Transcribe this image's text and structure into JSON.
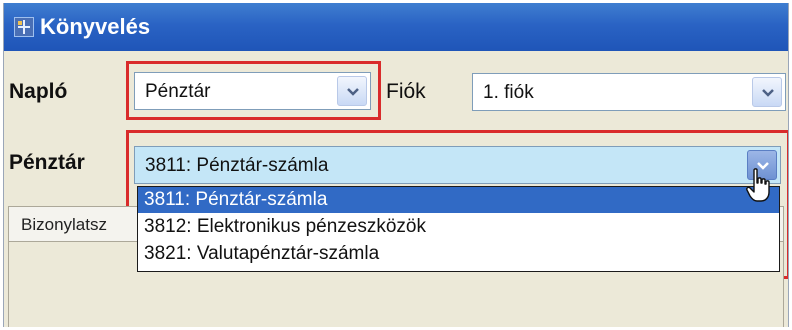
{
  "window": {
    "title": "Könyvelés",
    "icon": "app-icon"
  },
  "form": {
    "naplo": {
      "label": "Napló",
      "value": "Pénztár"
    },
    "fiok": {
      "label": "Fiók",
      "value": "1. fiók"
    },
    "penztar": {
      "label": "Pénztár",
      "value": "3811: Pénztár-számla",
      "options": [
        "3811: Pénztár-számla",
        "3812: Elektronikus pénzeszközök",
        "3821: Valutapénztár-számla"
      ],
      "selected_index": 0
    }
  },
  "grid": {
    "header_label": "Bizonylatsz"
  },
  "colors": {
    "titlebar": "#2a63c4",
    "highlight_border": "#d92b2b",
    "selection": "#316ac5",
    "open_combo": "#c4e6f7"
  },
  "icons": [
    "app-icon",
    "chevron-down-icon",
    "hand-cursor-icon",
    "stopwatch-icon"
  ]
}
